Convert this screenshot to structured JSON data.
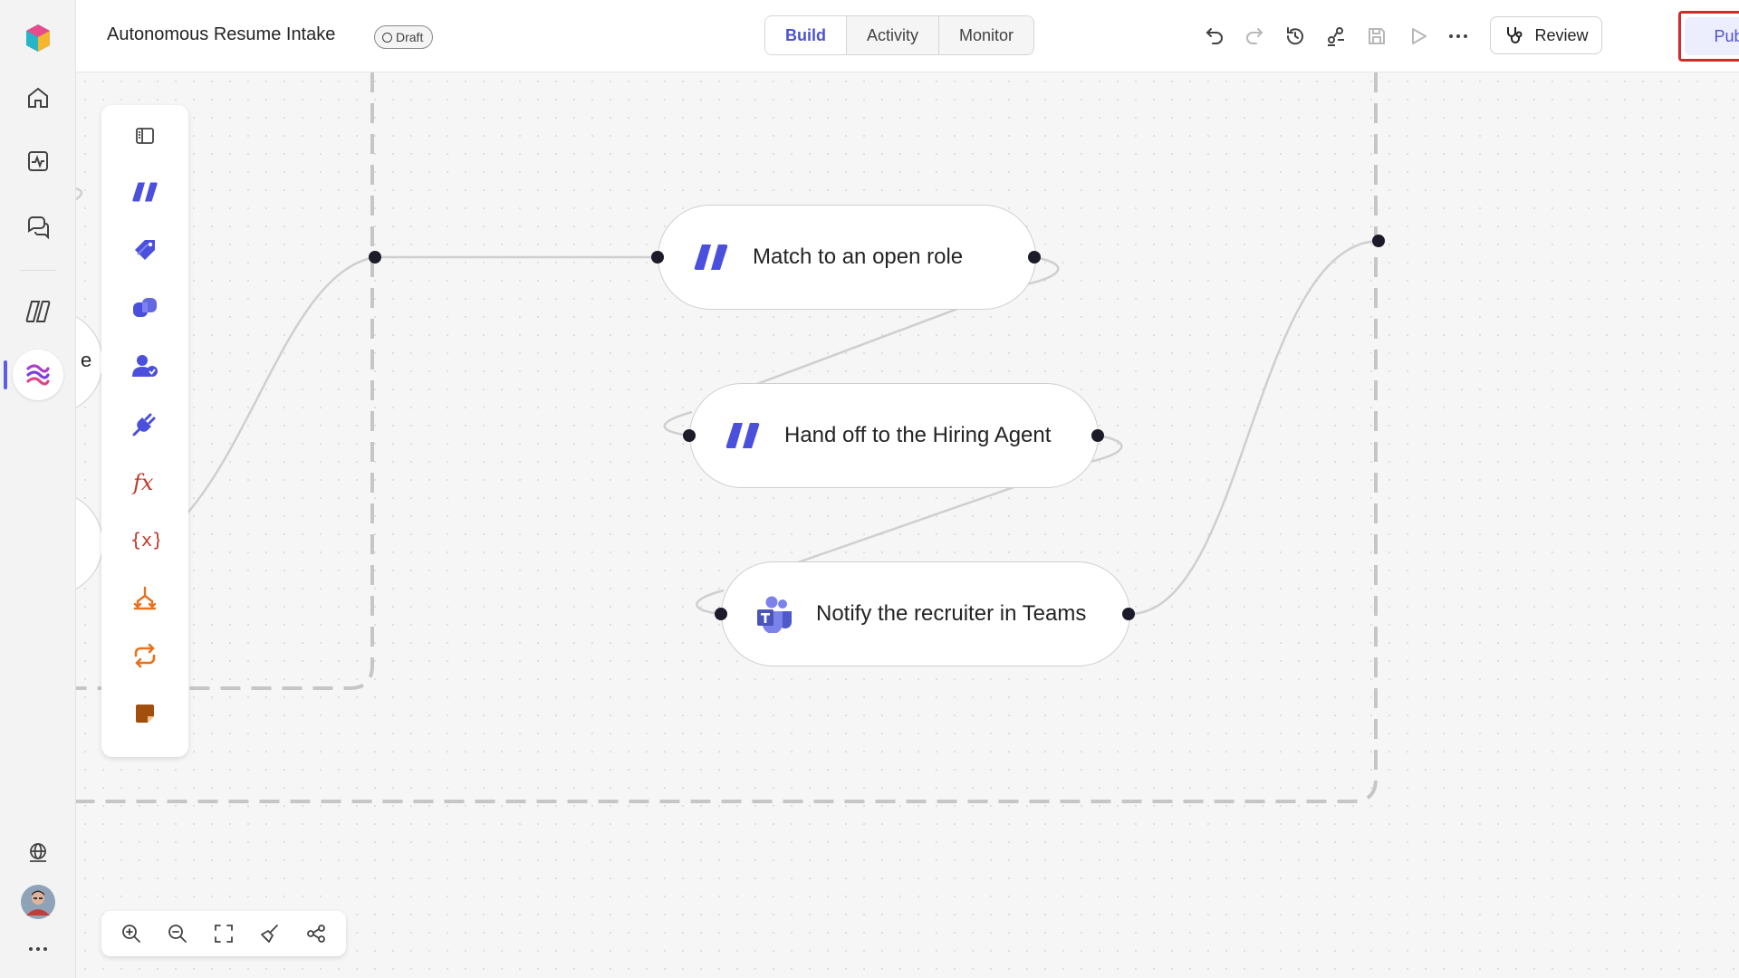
{
  "header": {
    "title": "Autonomous Resume Intake",
    "status": "Draft",
    "review_label": "Review",
    "publish_label": "Publish"
  },
  "tabs": [
    {
      "label": "Build",
      "active": true
    },
    {
      "label": "Activity",
      "active": false
    },
    {
      "label": "Monitor",
      "active": false
    }
  ],
  "toolbar_icons": [
    "undo-icon",
    "redo-icon",
    "history-icon",
    "connections-icon",
    "save-icon",
    "run-icon",
    "more-icon"
  ],
  "rail_icons": [
    "app-logo-icon",
    "home-icon",
    "activity-icon",
    "chat-icon",
    "agents-icon",
    "flows-icon",
    "globe-icon",
    "avatar",
    "more-icon"
  ],
  "palette_icons": [
    "toggle-panel-icon",
    "agent-icon",
    "tag-icon",
    "copilot-icon",
    "human-review-icon",
    "connector-plug-icon",
    "formula-icon",
    "variable-icon",
    "condition-icon",
    "loop-icon",
    "sticky-note-icon"
  ],
  "nodes": [
    {
      "label": "Match to an open role",
      "icon": "agent-icon"
    },
    {
      "label": "Hand off to the Hiring Agent",
      "icon": "agent-icon"
    },
    {
      "label": "Notify the recruiter in Teams",
      "icon": "teams-icon"
    }
  ],
  "partial_node_text": "e",
  "zoom_controls": [
    "zoom-in-icon",
    "zoom-out-icon",
    "fit-view-icon",
    "clean-up-icon",
    "layout-icon"
  ],
  "colors": {
    "accent": "#4f52cc",
    "highlight": "#d9262a",
    "formula": "#c0392b",
    "control": "#e8711c"
  }
}
